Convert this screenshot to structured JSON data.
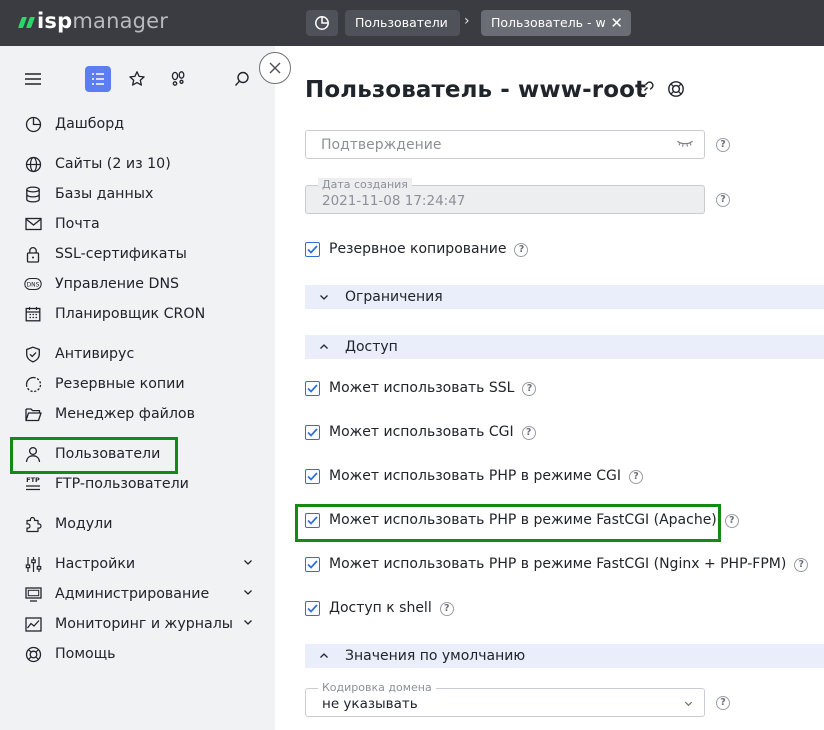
{
  "topbar": {
    "logo_prefix": "isp",
    "logo_suffix": "manager",
    "breadcrumbs": [
      {
        "label": "Пользователи"
      },
      {
        "label": "Пользователь - w"
      }
    ],
    "crumb_separator": "›",
    "close_tab_glyph": "✕"
  },
  "sidebar": {
    "items": [
      {
        "label": "Дашборд",
        "icon": "dashboard-icon"
      },
      {
        "label": "Сайты (2 из 10)",
        "icon": "globe-icon"
      },
      {
        "label": "Базы данных",
        "icon": "database-icon"
      },
      {
        "label": "Почта",
        "icon": "mail-icon"
      },
      {
        "label": "SSL-сертификаты",
        "icon": "lock-icon"
      },
      {
        "label": "Управление DNS",
        "icon": "dns-icon"
      },
      {
        "label": "Планировщик CRON",
        "icon": "calendar-icon"
      },
      {
        "label": "Антивирус",
        "icon": "shield-icon"
      },
      {
        "label": "Резервные копии",
        "icon": "backup-icon"
      },
      {
        "label": "Менеджер файлов",
        "icon": "folder-icon"
      },
      {
        "label": "Пользователи",
        "icon": "user-icon",
        "active": true
      },
      {
        "label": "FTP-пользователи",
        "icon": "ftp-icon"
      },
      {
        "label": "Модули",
        "icon": "puzzle-icon"
      },
      {
        "label": "Настройки",
        "icon": "sliders-icon",
        "expandable": true
      },
      {
        "label": "Администрирование",
        "icon": "monitor-icon",
        "expandable": true
      },
      {
        "label": "Мониторинг и журналы",
        "icon": "chart-icon",
        "expandable": true
      },
      {
        "label": "Помощь",
        "icon": "lifebuoy-icon"
      }
    ],
    "dns_icon_text": "DNS",
    "ftp_icon_text": "FTP"
  },
  "main": {
    "title": "Пользователь - www-root",
    "confirm_field": {
      "placeholder": "Подтверждение"
    },
    "created_field": {
      "label": "Дата создания",
      "value": "2021-11-08 17:24:47"
    },
    "backup_checkbox": {
      "label": "Резервное копирование",
      "checked": true
    },
    "sections": {
      "limits": "Ограничения",
      "access": "Доступ",
      "defaults": "Значения по умолчанию"
    },
    "access_options": [
      {
        "label": "Может использовать SSL",
        "checked": true
      },
      {
        "label": "Может использовать CGI",
        "checked": true
      },
      {
        "label": "Может использовать PHP в режиме CGI",
        "checked": true
      },
      {
        "label": "Может использовать PHP в режиме FastCGI (Apache)",
        "checked": true
      },
      {
        "label": "Может использовать PHP в режиме FastCGI (Nginx + PHP-FPM)",
        "checked": true
      },
      {
        "label": "Доступ к shell",
        "checked": true
      }
    ],
    "domain_encoding": {
      "label": "Кодировка домена",
      "value": "не указывать"
    },
    "help_glyph": "?"
  },
  "colors": {
    "topbar_bg": "#3a3c41",
    "logo_accent": "#2ad86a",
    "sidebar_bg": "#f1f2f4",
    "active_tool": "#5b7ff0",
    "checkbox": "#2f6fd6",
    "section_bg": "#e9eefa",
    "highlight": "#138a13"
  }
}
